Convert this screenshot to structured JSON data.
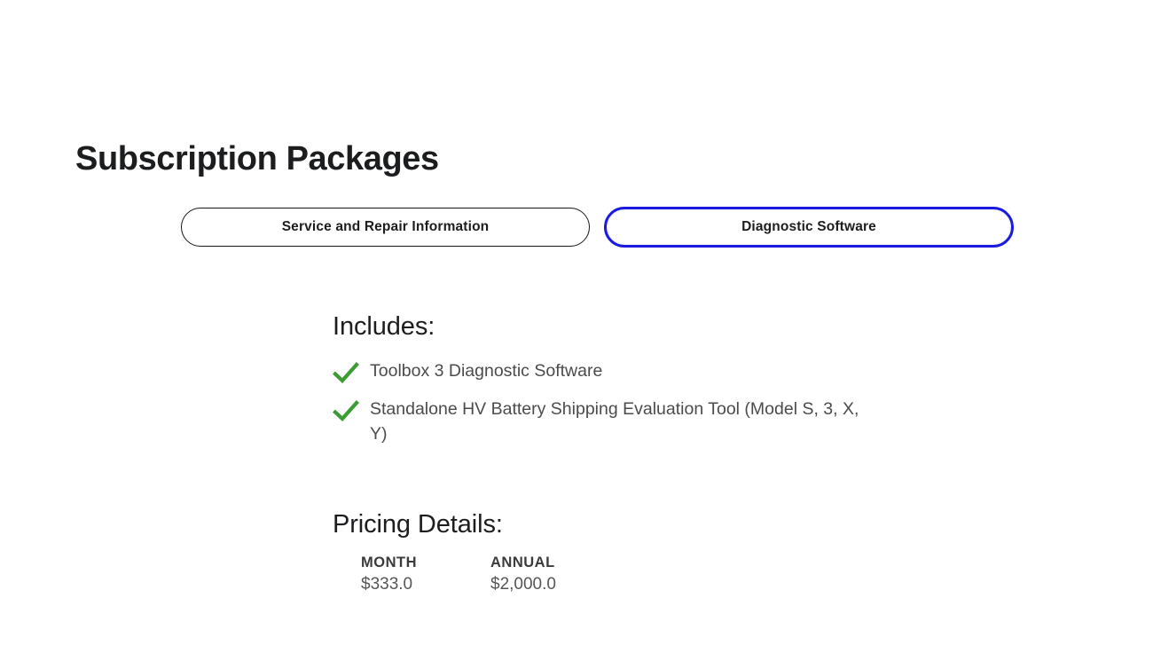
{
  "page": {
    "title": "Subscription Packages"
  },
  "tabs": [
    {
      "label": "Service and Repair Information",
      "active": false,
      "name": "tab-service-and-repair-information"
    },
    {
      "label": "Diagnostic Software",
      "active": true,
      "name": "tab-diagnostic-software"
    }
  ],
  "includes": {
    "heading": "Includes:",
    "items": [
      {
        "label": "Toolbox 3 Diagnostic Software",
        "icon": "check-icon"
      },
      {
        "label": "Standalone HV Battery Shipping Evaluation Tool (Model S, 3, X, Y)",
        "icon": "check-icon"
      }
    ]
  },
  "pricing": {
    "heading": "Pricing Details:",
    "columns": [
      "MONTH",
      "ANNUAL"
    ],
    "values": [
      "$333.0",
      "$2,000.0"
    ]
  },
  "colors": {
    "accent_blue": "#1a1ae0",
    "check_green": "#3d9b35",
    "title_text": "#1c1d1f",
    "body_text": "#4a4b4d",
    "page_background": "#ffffff"
  }
}
